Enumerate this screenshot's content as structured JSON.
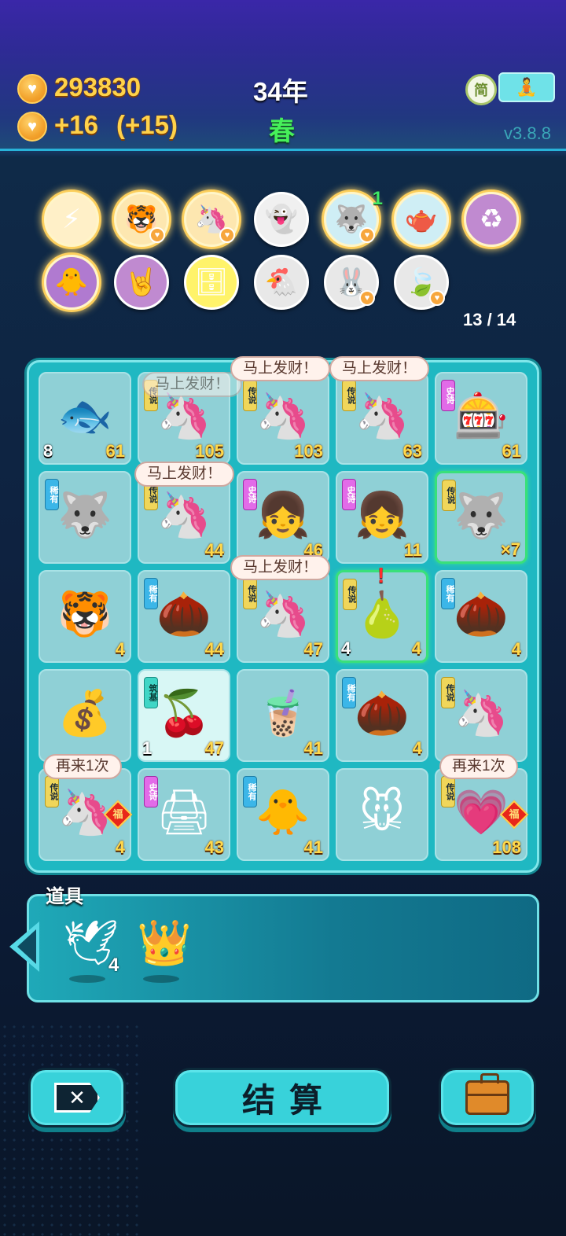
{
  "header": {
    "coins": "293830",
    "income": "+16",
    "income_bonus": "(+15)",
    "year": "34年",
    "season": "春",
    "lang_label": "简",
    "version": "v3.8.8"
  },
  "collection": {
    "progress": "13 / 14",
    "row1": [
      {
        "icon": "lightning-icon",
        "glyph": "⚡",
        "bg": "#fff0c8",
        "count": ""
      },
      {
        "icon": "tiger-icon",
        "glyph": "🐯",
        "bg": "#fde7b0",
        "count": ""
      },
      {
        "icon": "unicorn-icon",
        "glyph": "🦄",
        "bg": "#fde7b0",
        "count": ""
      },
      {
        "icon": "ghost-icon",
        "glyph": "👻",
        "bg": "#f0f0f0",
        "count": ""
      },
      {
        "icon": "husky-icon",
        "glyph": "🐺",
        "bg": "#cfeef5",
        "count": "1"
      },
      {
        "icon": "gravy-boat-icon",
        "glyph": "🫖",
        "bg": "#cfeef5",
        "count": ""
      },
      {
        "icon": "recycle-icon",
        "glyph": "♻",
        "bg": "#c08ad0",
        "count": ""
      }
    ],
    "row2": [
      {
        "icon": "sunglasses-chick-icon",
        "glyph": "🐥",
        "bg": "#b07ad0",
        "count": ""
      },
      {
        "icon": "rock-hand-icon",
        "glyph": "🤘",
        "bg": "#c08ad0",
        "count": ""
      },
      {
        "icon": "safe-icon",
        "glyph": "🗄",
        "bg": "#fff36a",
        "count": ""
      },
      {
        "icon": "hen-egg-icon",
        "glyph": "🐔",
        "bg": "#e8e8e8",
        "count": ""
      },
      {
        "icon": "rabbit-icon",
        "glyph": "🐰",
        "bg": "#e8e8e8",
        "count": ""
      },
      {
        "icon": "leaf-icon",
        "glyph": "🍃",
        "bg": "#e8e8e8",
        "count": ""
      }
    ]
  },
  "board": {
    "cells": [
      {
        "name": "fish",
        "glyph": "🐟",
        "tag": "",
        "tag_class": "",
        "value": "61",
        "left_num": "8"
      },
      {
        "name": "unicorn",
        "glyph": "🦄",
        "tag": "传说",
        "tag_class": "t-legend",
        "value": "105",
        "left_num": ""
      },
      {
        "name": "unicorn",
        "glyph": "🦄",
        "tag": "传说",
        "tag_class": "t-legend",
        "value": "103",
        "left_num": ""
      },
      {
        "name": "unicorn",
        "glyph": "🦄",
        "tag": "传说",
        "tag_class": "t-legend",
        "value": "63",
        "left_num": ""
      },
      {
        "name": "gacha-machine",
        "glyph": "🎰",
        "tag": "史诗",
        "tag_class": "t-epic",
        "value": "61",
        "left_num": ""
      },
      {
        "name": "husky",
        "glyph": "🐺",
        "tag": "稀有",
        "tag_class": "t-rare",
        "value": "",
        "left_num": ""
      },
      {
        "name": "unicorn",
        "glyph": "🦄",
        "tag": "传说",
        "tag_class": "t-legend",
        "value": "44",
        "left_num": ""
      },
      {
        "name": "girl",
        "glyph": "👧",
        "tag": "史诗",
        "tag_class": "t-epic",
        "value": "46",
        "left_num": ""
      },
      {
        "name": "girl",
        "glyph": "👧",
        "tag": "史诗",
        "tag_class": "t-epic",
        "value": "11",
        "left_num": ""
      },
      {
        "name": "king-husky",
        "glyph": "🐺",
        "tag": "传说",
        "tag_class": "t-legend",
        "value": "×7",
        "left_num": ""
      },
      {
        "name": "tiger",
        "glyph": "🐯",
        "tag": "",
        "tag_class": "",
        "value": "4",
        "left_num": ""
      },
      {
        "name": "walnut",
        "glyph": "🌰",
        "tag": "稀有",
        "tag_class": "t-rare",
        "value": "44",
        "left_num": ""
      },
      {
        "name": "unicorn",
        "glyph": "🦄",
        "tag": "传说",
        "tag_class": "t-legend",
        "value": "47",
        "left_num": ""
      },
      {
        "name": "pear",
        "glyph": "🍐",
        "tag": "传说",
        "tag_class": "t-legend",
        "value": "4",
        "left_num": "4"
      },
      {
        "name": "walnut",
        "glyph": "🌰",
        "tag": "稀有",
        "tag_class": "t-rare",
        "value": "4",
        "left_num": ""
      },
      {
        "name": "coin-pile",
        "glyph": "💰",
        "tag": "",
        "tag_class": "",
        "value": "",
        "left_num": ""
      },
      {
        "name": "cherries",
        "glyph": "🍒",
        "tag": "筑基",
        "tag_class": "t-base",
        "value": "47",
        "left_num": "1"
      },
      {
        "name": "bubble-tea",
        "glyph": "🧋",
        "tag": "",
        "tag_class": "",
        "value": "41",
        "left_num": ""
      },
      {
        "name": "walnut",
        "glyph": "🌰",
        "tag": "稀有",
        "tag_class": "t-rare",
        "value": "4",
        "left_num": ""
      },
      {
        "name": "unicorn",
        "glyph": "🦄",
        "tag": "传说",
        "tag_class": "t-legend",
        "value": "",
        "left_num": ""
      },
      {
        "name": "unicorn",
        "glyph": "🦄",
        "tag": "传说",
        "tag_class": "t-legend",
        "value": "4",
        "left_num": ""
      },
      {
        "name": "printer",
        "glyph": "🖨",
        "tag": "史诗",
        "tag_class": "t-epic",
        "value": "43",
        "left_num": ""
      },
      {
        "name": "chick",
        "glyph": "🐥",
        "tag": "稀有",
        "tag_class": "t-rare",
        "value": "41",
        "left_num": ""
      },
      {
        "name": "rat",
        "glyph": "🐭",
        "tag": "",
        "tag_class": "",
        "value": "",
        "left_num": ""
      },
      {
        "name": "heart-boy",
        "glyph": "💗",
        "tag": "传说",
        "tag_class": "t-legend",
        "value": "108",
        "left_num": ""
      }
    ],
    "fu_label": "福",
    "bubbles": {
      "fortune": "马上发财！",
      "again": "再来1次"
    }
  },
  "items": {
    "label": "道具",
    "list": [
      {
        "name": "dove",
        "glyph": "🕊",
        "count": "4"
      },
      {
        "name": "crown",
        "glyph": "👑",
        "count": ""
      }
    ]
  },
  "buttons": {
    "settle": "结算"
  }
}
